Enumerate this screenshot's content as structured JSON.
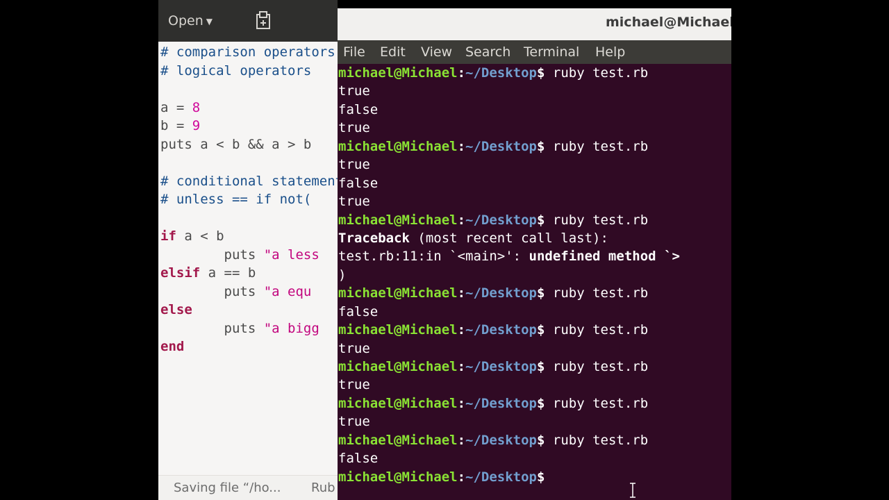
{
  "editor": {
    "open_label": "Open",
    "code_lines": [
      "# comparison operators",
      "# logical operators",
      "",
      "a = 8",
      "b = 9",
      "puts a < b && a > b",
      "",
      "# conditional statements",
      "# unless == if not(",
      "",
      "if a < b",
      "        puts \"a less",
      "elsif a == b",
      "        puts \"a equ",
      "else",
      "        puts \"a bigg",
      "end"
    ],
    "status_saving": "Saving file “/ho...",
    "status_lang": "Rub"
  },
  "terminal": {
    "title": "michael@Michael: ~/Desktop",
    "menu": [
      "File",
      "Edit",
      "View",
      "Search",
      "Terminal",
      "Help"
    ],
    "prompt": {
      "user": "michael@Michael",
      "sep": ":",
      "path": "~/Desktop",
      "symbol": "$"
    },
    "command": "ruby test.rb",
    "lines": [
      {
        "kind": "prompt",
        "cmd": "ruby test.rb"
      },
      {
        "kind": "out",
        "text": "true"
      },
      {
        "kind": "out",
        "text": "false"
      },
      {
        "kind": "out",
        "text": "true"
      },
      {
        "kind": "prompt",
        "cmd": "ruby test.rb"
      },
      {
        "kind": "out",
        "text": "true"
      },
      {
        "kind": "out",
        "text": "false"
      },
      {
        "kind": "out",
        "text": "true"
      },
      {
        "kind": "prompt",
        "cmd": "ruby test.rb"
      },
      {
        "kind": "bold",
        "text": "Traceback",
        "rest": " (most recent call last):"
      },
      {
        "kind": "err",
        "text": "test.rb:11:in `<main>': ",
        "bold": "undefined method `>"
      },
      {
        "kind": "out",
        "text": ")"
      },
      {
        "kind": "prompt",
        "cmd": "ruby test.rb"
      },
      {
        "kind": "out",
        "text": "false"
      },
      {
        "kind": "prompt",
        "cmd": "ruby test.rb"
      },
      {
        "kind": "out",
        "text": "true"
      },
      {
        "kind": "prompt",
        "cmd": "ruby test.rb"
      },
      {
        "kind": "out",
        "text": "true"
      },
      {
        "kind": "prompt",
        "cmd": "ruby test.rb"
      },
      {
        "kind": "out",
        "text": "true"
      },
      {
        "kind": "prompt",
        "cmd": "ruby test.rb"
      },
      {
        "kind": "out",
        "text": "false"
      },
      {
        "kind": "prompt",
        "cmd": ""
      }
    ]
  },
  "colors": {
    "terminal_bg": "#300a24",
    "prompt_user": "#8ae234",
    "prompt_path": "#729fcf",
    "editor_bg": "#f6f5f4",
    "header_bg": "#2f2f2d"
  },
  "icons": [
    "new-document-icon",
    "caret-down-icon",
    "text-cursor-icon"
  ]
}
